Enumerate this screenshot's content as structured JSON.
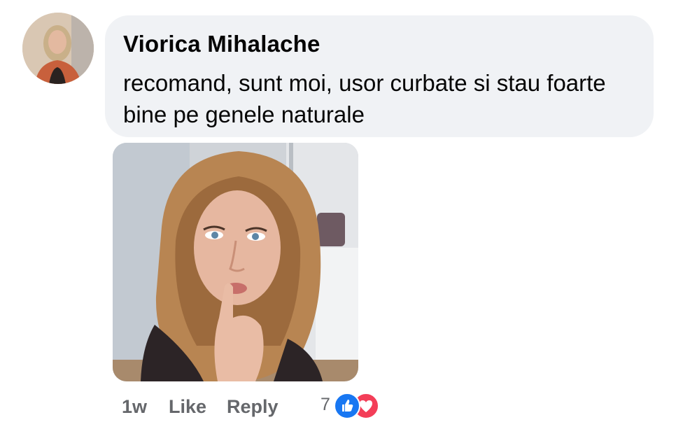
{
  "comment": {
    "author": "Viorica Mihalache",
    "text": "recomand, sunt moi, usor curbate si stau foarte bine pe genele naturale",
    "avatar_icon": "profile-photo",
    "attachment_icon": "selfie-photo"
  },
  "meta": {
    "time": "1w",
    "like_label": "Like",
    "reply_label": "Reply",
    "reaction_count": "7",
    "reaction_icons": [
      "like-reaction-icon",
      "love-reaction-icon"
    ]
  },
  "colors": {
    "bubble_bg": "#f0f2f5",
    "text": "#050505",
    "meta_text": "#65676b",
    "like_blue": "#1877f2",
    "love_red": "#f33e58"
  }
}
